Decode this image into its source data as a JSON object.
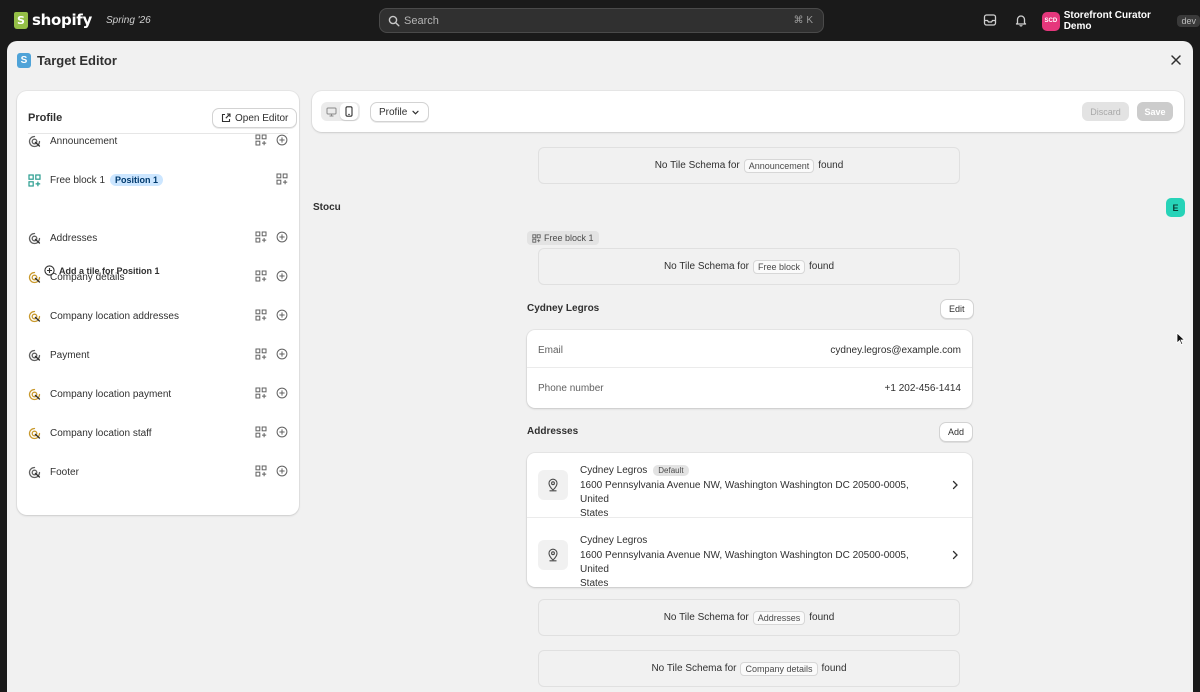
{
  "topbar": {
    "brand": "shopify",
    "edition": "Spring '26",
    "search_placeholder": "Search",
    "shortcut": "⌘  K",
    "store_initials": "SCD",
    "store_name": "Storefront Curator Demo",
    "env_badge": "dev"
  },
  "modal": {
    "title": "Target Editor"
  },
  "left_panel": {
    "title": "Profile",
    "open_editor_label": "Open Editor",
    "items": [
      {
        "label": "Announcement",
        "icon": "target-icon",
        "color": "#616161"
      },
      {
        "label": "Free block 1",
        "icon": "blocks-icon",
        "color": "#2a9d8f",
        "badge": "Position 1"
      },
      {
        "label": "Addresses",
        "icon": "target-icon",
        "color": "#616161"
      },
      {
        "label": "Company details",
        "icon": "target-icon",
        "color": "#c99a2e"
      },
      {
        "label": "Company location addresses",
        "icon": "target-icon",
        "color": "#c99a2e"
      },
      {
        "label": "Payment",
        "icon": "target-icon",
        "color": "#616161"
      },
      {
        "label": "Company location payment",
        "icon": "target-icon",
        "color": "#c99a2e"
      },
      {
        "label": "Company location staff",
        "icon": "target-icon",
        "color": "#c99a2e"
      },
      {
        "label": "Footer",
        "icon": "target-icon",
        "color": "#616161"
      }
    ],
    "add_tile_label": "Add a tile for Position 1"
  },
  "toolbar": {
    "profile_select": "Profile",
    "discard_label": "Discard",
    "save_label": "Save"
  },
  "preview": {
    "no_schema_prefix": "No Tile Schema for",
    "no_schema_suffix": "found",
    "announcement_schema": "Announcement",
    "stocu_label": "Stocu",
    "e_badge": "E",
    "free_block_chip": "Free block 1",
    "free_block_schema": "Free block",
    "customer": {
      "name": "Cydney Legros",
      "edit_label": "Edit",
      "email_label": "Email",
      "email_value": "cydney.legros@example.com",
      "phone_label": "Phone number",
      "phone_value": "+1 202-456-1414"
    },
    "addresses": {
      "title": "Addresses",
      "add_label": "Add",
      "items": [
        {
          "name": "Cydney Legros",
          "badge": "Default",
          "line1": "1600 Pennsylvania Avenue NW, Washington Washington DC 20500-0005, United",
          "line2": "States"
        },
        {
          "name": "Cydney Legros",
          "line1": "1600 Pennsylvania Avenue NW, Washington Washington DC 20500-0005, United",
          "line2": "States"
        }
      ]
    },
    "addresses_schema": "Addresses",
    "company_details_schema": "Company details"
  }
}
